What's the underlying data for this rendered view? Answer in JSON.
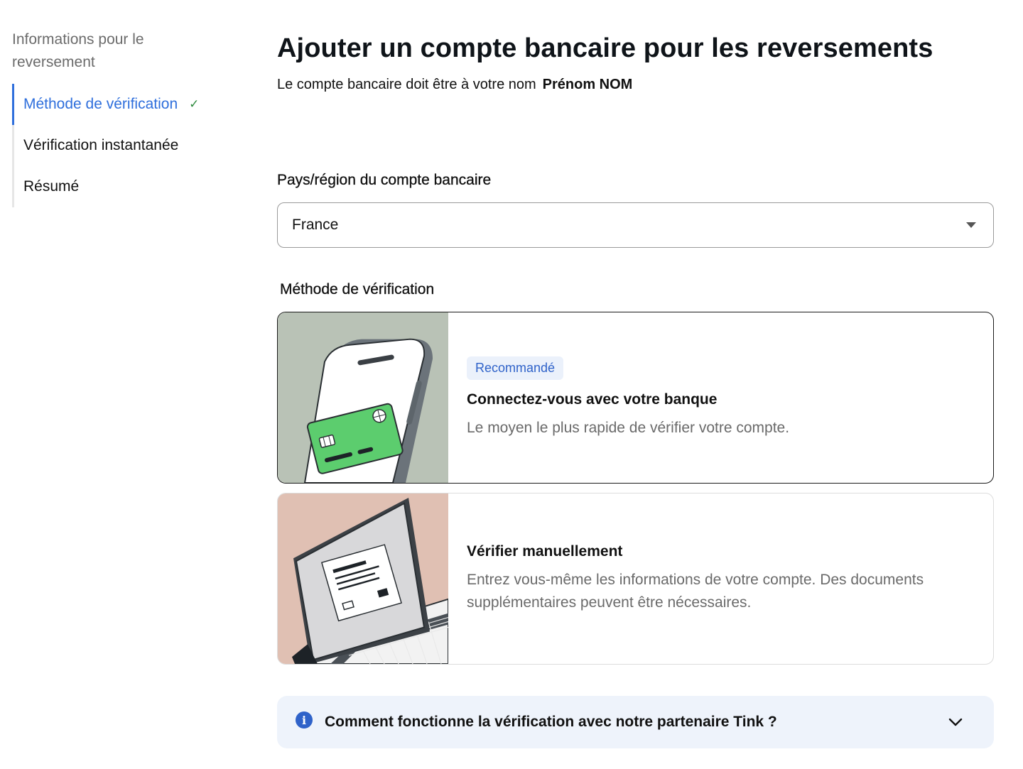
{
  "sidebar": {
    "header": "Informations pour le reversement",
    "steps": [
      {
        "label": "Méthode de vérification",
        "active": true,
        "completed": true
      },
      {
        "label": "Vérification instantanée",
        "active": false,
        "completed": false
      },
      {
        "label": "Résumé",
        "active": false,
        "completed": false
      }
    ],
    "check_glyph": "✓"
  },
  "main": {
    "title": "Ajouter un compte bancaire pour les reversements",
    "subtitle_text": "Le compte bancaire doit être à votre nom",
    "account_holder": "Prénom NOM",
    "country": {
      "label": "Pays/région du compte bancaire",
      "selected": "France"
    },
    "method": {
      "label": "Méthode de vérification",
      "options": [
        {
          "badge": "Recommandé",
          "title": "Connectez-vous avec votre banque",
          "description": "Le moyen le plus rapide de vérifier votre compte.",
          "illustration": "phone-card-illustration"
        },
        {
          "title": "Vérifier manuellement",
          "description": "Entrez vous-même les informations de votre compte. Des documents supplémentaires peuvent être nécessaires.",
          "illustration": "laptop-document-illustration"
        }
      ]
    },
    "faq": {
      "question": "Comment fonctionne la vérification avec notre partenaire Tink ?",
      "icon": "info-icon",
      "expand_icon": "chevron-down-icon"
    }
  },
  "colors": {
    "accent": "#2f6fdc",
    "check": "#2e8b3e",
    "badge_bg": "#ebf1fb",
    "faq_bg": "#eef3fb",
    "phone_bg": "#b9c2b6",
    "laptop_bg": "#e0c0b3",
    "card_green": "#5ccd6e"
  }
}
